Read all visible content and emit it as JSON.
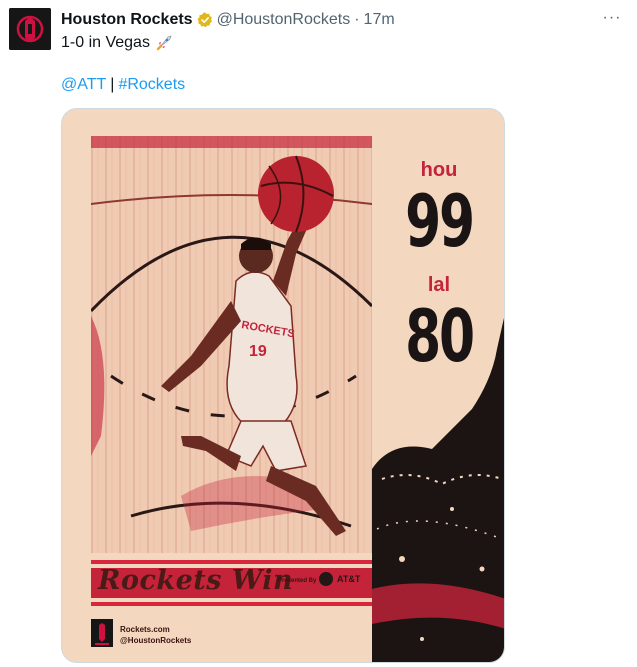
{
  "author": {
    "name": "Houston Rockets",
    "handle": "@HoustonRockets",
    "separator": "·",
    "time": "17m",
    "verified_color": "#e2b719",
    "avatar_icon": "rockets-logo-icon"
  },
  "menu": {
    "label": "···"
  },
  "tweet": {
    "line1": "1-0 in Vegas",
    "emoji": "rocket-emoji",
    "mention": "@ATT",
    "separator": "|",
    "hashtag": "#Rockets",
    "link_color": "#1d9bf0"
  },
  "graphic": {
    "team_home": "hou",
    "score_home": "99",
    "team_away": "lal",
    "score_away": "80",
    "banner_title": "Rockets Win",
    "presented_by": "Presented By",
    "sponsor": "AT&T",
    "site": "Rockets.com",
    "social": "@HoustonRockets",
    "jersey_text": "ROCKETS",
    "jersey_number": "19",
    "accent_color": "#c4233a",
    "paper_color": "#f3d8bf"
  }
}
